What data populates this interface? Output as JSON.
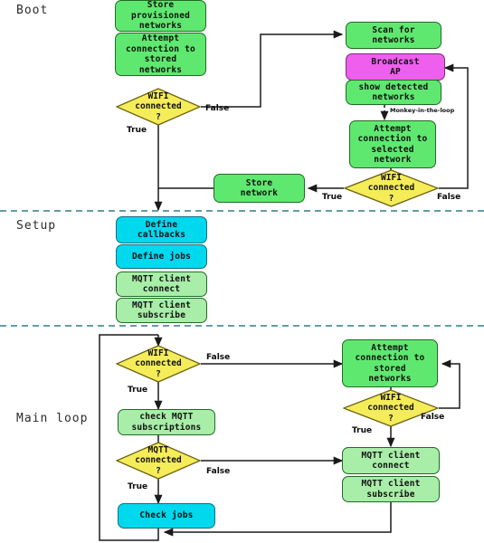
{
  "diagram": {
    "title": "IoT device boot / setup / main loop flowchart",
    "colors": {
      "green": "#5fe870",
      "light_green": "#a8eda8",
      "cyan": "#00d8ee",
      "magenta": "#ee5fee",
      "diamond": "#f5ec5a",
      "edge": "#1a1a1a",
      "divider": "#2e7d8a",
      "background": "#ffffff"
    },
    "sections": [
      {
        "name": "boot",
        "label": "Boot"
      },
      {
        "name": "setup",
        "label": "Setup"
      },
      {
        "name": "main_loop",
        "label": "Main loop"
      }
    ],
    "boot": {
      "nodes": [
        {
          "id": "store_provisioned",
          "label": "Store\nprovisioned\nnetworks",
          "shape": "box",
          "color": "green"
        },
        {
          "id": "attempt_stored",
          "label": "Attempt\nconnection to\nstored\nnetworks",
          "shape": "box",
          "color": "green"
        },
        {
          "id": "wifi_connected_1",
          "label": "WIFI\nconnected\n?",
          "shape": "diamond",
          "color": "diamond"
        },
        {
          "id": "scan_networks",
          "label": "Scan for\nnetworks",
          "shape": "box",
          "color": "green"
        },
        {
          "id": "broadcast_ap",
          "label": "Broadcast\nAP",
          "shape": "box",
          "color": "magenta"
        },
        {
          "id": "show_detected",
          "label": "show detected\nnetworks",
          "shape": "box",
          "color": "green"
        },
        {
          "id": "attempt_selected",
          "label": "Attempt\nconnection to\nselected\nnetwork",
          "shape": "box",
          "color": "green"
        },
        {
          "id": "wifi_connected_2",
          "label": "WIFI\nconnected\n?",
          "shape": "diamond",
          "color": "diamond"
        },
        {
          "id": "store_network",
          "label": "Store\nnetwork",
          "shape": "box",
          "color": "green"
        }
      ],
      "edge_labels": [
        {
          "id": "boot_false_1",
          "text": "False"
        },
        {
          "id": "boot_true_1",
          "text": "True"
        },
        {
          "id": "boot_true_2",
          "text": "True"
        },
        {
          "id": "boot_false_2",
          "text": "False"
        }
      ],
      "notes": [
        {
          "id": "monkey_note",
          "text": "Monkey-in-the-loop"
        }
      ]
    },
    "setup": {
      "nodes": [
        {
          "id": "define_callbacks",
          "label": "Define\ncallbacks",
          "shape": "box",
          "color": "cyan"
        },
        {
          "id": "define_jobs",
          "label": "Define jobs",
          "shape": "box",
          "color": "cyan"
        },
        {
          "id": "mqtt_connect_s",
          "label": "MQTT client\nconnect",
          "shape": "box",
          "color": "light_green"
        },
        {
          "id": "mqtt_subscribe_s",
          "label": "MQTT client\nsubscribe",
          "shape": "box",
          "color": "light_green"
        }
      ]
    },
    "main_loop": {
      "nodes": [
        {
          "id": "wifi_connected_3",
          "label": "WIFI\nconnected\n?",
          "shape": "diamond",
          "color": "diamond"
        },
        {
          "id": "check_mqtt_subs",
          "label": "check MQTT\nsubscriptions",
          "shape": "box",
          "color": "light_green"
        },
        {
          "id": "mqtt_connected",
          "label": "MQTT\nconnected\n?",
          "shape": "diamond",
          "color": "diamond"
        },
        {
          "id": "check_jobs",
          "label": "Check jobs",
          "shape": "box",
          "color": "cyan"
        },
        {
          "id": "attempt_stored_2",
          "label": "Attempt\nconnection to\nstored\nnetworks",
          "shape": "box",
          "color": "green"
        },
        {
          "id": "wifi_connected_4",
          "label": "WIFI\nconnected\n?",
          "shape": "diamond",
          "color": "diamond"
        },
        {
          "id": "mqtt_connect_m",
          "label": "MQTT client\nconnect",
          "shape": "box",
          "color": "light_green"
        },
        {
          "id": "mqtt_subscribe_m",
          "label": "MQTT client\nsubscribe",
          "shape": "box",
          "color": "light_green"
        }
      ],
      "edge_labels": [
        {
          "id": "ml_false_1",
          "text": "False"
        },
        {
          "id": "ml_true_1",
          "text": "True"
        },
        {
          "id": "ml_false_2",
          "text": "False"
        },
        {
          "id": "ml_true_2",
          "text": "True"
        },
        {
          "id": "ml_false_3",
          "text": "False"
        },
        {
          "id": "ml_true_3",
          "text": "True"
        }
      ]
    }
  }
}
